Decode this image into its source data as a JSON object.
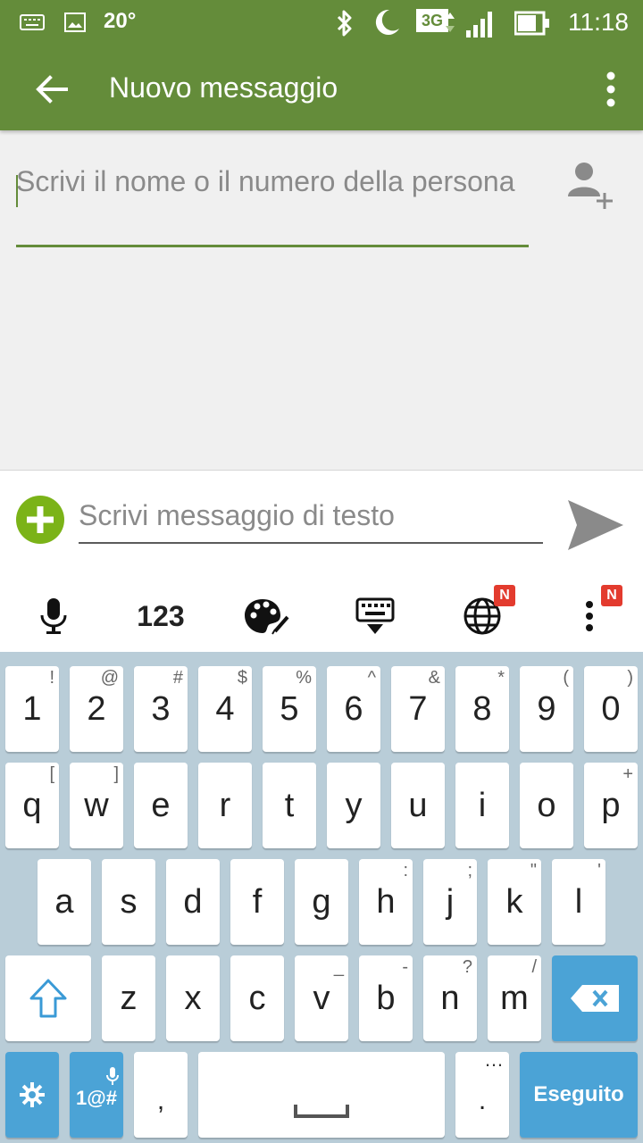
{
  "status_bar": {
    "temperature": "20°",
    "time": "11:18",
    "network": "3G"
  },
  "app_bar": {
    "title": "Nuovo messaggio"
  },
  "recipient": {
    "placeholder": "Scrivi il nome o il numero della persona"
  },
  "compose": {
    "placeholder": "Scrivi messaggio di testo"
  },
  "keyboard_toolbar": {
    "numbers_label": "123",
    "badge": "N"
  },
  "keyboard": {
    "row1": [
      {
        "k": "1",
        "a": "!"
      },
      {
        "k": "2",
        "a": "@"
      },
      {
        "k": "3",
        "a": "#"
      },
      {
        "k": "4",
        "a": "$"
      },
      {
        "k": "5",
        "a": "%"
      },
      {
        "k": "6",
        "a": "^"
      },
      {
        "k": "7",
        "a": "&"
      },
      {
        "k": "8",
        "a": "*"
      },
      {
        "k": "9",
        "a": "("
      },
      {
        "k": "0",
        "a": ")"
      }
    ],
    "row2": [
      {
        "k": "q",
        "a": "["
      },
      {
        "k": "w",
        "a": "]"
      },
      {
        "k": "e",
        "a": ""
      },
      {
        "k": "r",
        "a": ""
      },
      {
        "k": "t",
        "a": ""
      },
      {
        "k": "y",
        "a": ""
      },
      {
        "k": "u",
        "a": ""
      },
      {
        "k": "i",
        "a": ""
      },
      {
        "k": "o",
        "a": ""
      },
      {
        "k": "p",
        "a": "+"
      }
    ],
    "row3": [
      {
        "k": "a",
        "a": ""
      },
      {
        "k": "s",
        "a": ""
      },
      {
        "k": "d",
        "a": ""
      },
      {
        "k": "f",
        "a": ""
      },
      {
        "k": "g",
        "a": ""
      },
      {
        "k": "h",
        "a": ":"
      },
      {
        "k": "j",
        "a": ";"
      },
      {
        "k": "k",
        "a": "\""
      },
      {
        "k": "l",
        "a": "'"
      }
    ],
    "row4": [
      {
        "k": "z",
        "a": ""
      },
      {
        "k": "x",
        "a": ""
      },
      {
        "k": "c",
        "a": ""
      },
      {
        "k": "v",
        "a": "_"
      },
      {
        "k": "b",
        "a": "-"
      },
      {
        "k": "n",
        "a": "?"
      },
      {
        "k": "m",
        "a": "/"
      }
    ],
    "symbols_label": "1@#",
    "comma": ",",
    "period": ".",
    "period_alt": "…",
    "done_label": "Eseguito"
  }
}
